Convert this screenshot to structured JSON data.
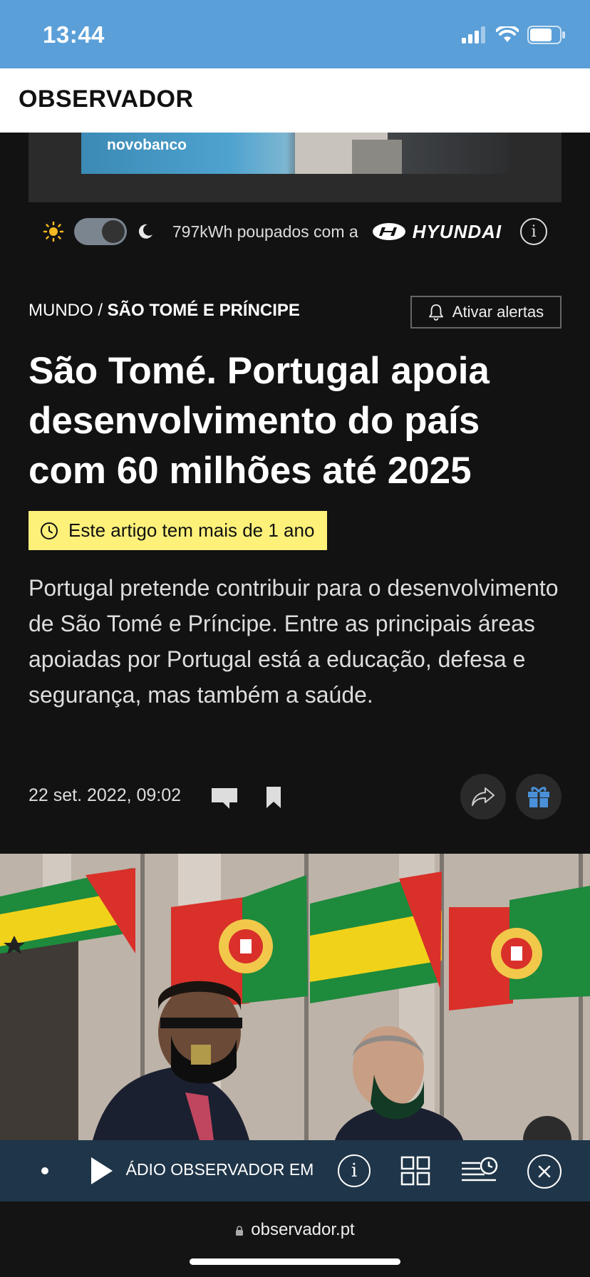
{
  "status": {
    "time": "13:44"
  },
  "header": {
    "logo": "OBSERVADOR"
  },
  "ad": {
    "brand": "novobanco"
  },
  "energy": {
    "text": "797kWh poupados com a",
    "sponsor": "HYUNDAI",
    "dark_mode_on": true
  },
  "article": {
    "section": "MUNDO /",
    "subsection": "SÃO TOMÉ E PRÍNCIPE",
    "alerts_label": "Ativar alertas",
    "title": "São Tomé. Portugal apoia desenvolvimento do país com 60 milhões até 2025",
    "age_notice": "Este artigo tem mais de 1 ano",
    "lead": "Portugal pretende contribuir para o desenvolvimento de São Tomé e Príncipe. Entre as principais áreas apoiadas por Portugal está a educação, defesa e segurança, mas também a saúde.",
    "date": "22 set. 2022, 09:02"
  },
  "radio": {
    "ticker": "RÁDIO OBSERVADOR EM DIRETO"
  },
  "browser": {
    "url": "observador.pt"
  },
  "colors": {
    "status_bar": "#5a9fd8",
    "badge": "#fdf17a",
    "radio_bar": "#1f3549",
    "gift": "#4a90d9",
    "sun": "#f5b820"
  }
}
